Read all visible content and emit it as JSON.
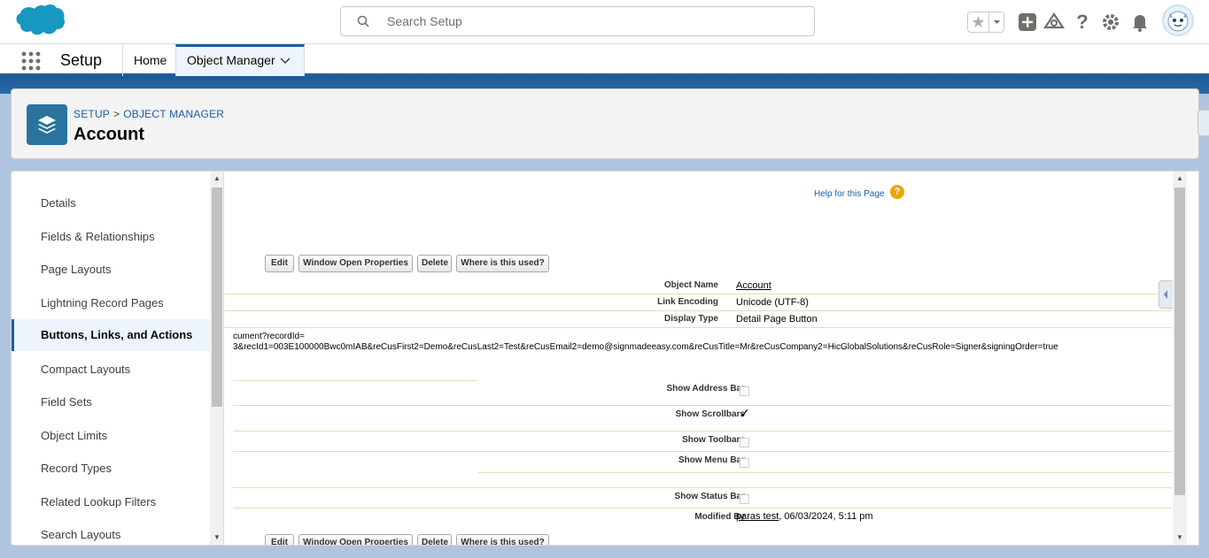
{
  "global_header": {
    "search_placeholder": "Search Setup"
  },
  "app_nav": {
    "app_name": "Setup",
    "tabs": [
      {
        "label": "Home"
      },
      {
        "label": "Object Manager"
      }
    ]
  },
  "page_header": {
    "breadcrumb": [
      "SETUP",
      "OBJECT MANAGER"
    ],
    "breadcrumb_separator": ">",
    "title": "Account"
  },
  "sidebar": {
    "items": [
      {
        "label": "Details"
      },
      {
        "label": "Fields & Relationships"
      },
      {
        "label": "Page Layouts"
      },
      {
        "label": "Lightning Record Pages"
      },
      {
        "label": "Buttons, Links, and Actions",
        "active": true
      },
      {
        "label": "Compact Layouts"
      },
      {
        "label": "Field Sets"
      },
      {
        "label": "Object Limits"
      },
      {
        "label": "Record Types"
      },
      {
        "label": "Related Lookup Filters"
      },
      {
        "label": "Search Layouts"
      }
    ]
  },
  "main": {
    "help_link": "Help for this Page",
    "help_icon": "?",
    "buttons": {
      "edit": "Edit",
      "window_open": "Window Open Properties",
      "delete": "Delete",
      "where_used": "Where is this used?"
    },
    "details": {
      "object_name_label": "Object Name",
      "object_name_value": "Account",
      "link_encoding_label": "Link Encoding",
      "link_encoding_value": "Unicode (UTF-8)",
      "display_type_label": "Display Type",
      "display_type_value": "Detail Page Button",
      "url_line1": "cument?recordId=",
      "url_line2": "3&recId1=003E100000Bwc0mIAB&reCusFirst2=Demo&reCusLast2=Test&reCusEmail2=demo@signmadeeasy.com&reCusTitle=Mr&reCusCompany2=HicGlobalSolutions&reCusRole=Signer&signingOrder=true",
      "show_address_bar_label": "Show Address Bar",
      "show_scrollbars_label": "Show Scrollbars",
      "show_scrollbars_check": "✓",
      "show_toolbars_label": "Show Toolbars",
      "show_menu_bar_label": "Show Menu Bar",
      "show_status_bar_label": "Show Status Bar",
      "modified_by_label": "Modified By",
      "modified_by_user": "paras test",
      "modified_by_date": ", 06/03/2024, 5:11 pm"
    }
  },
  "colors": {
    "brand_blue": "#1b5f9e",
    "link_blue": "#1b5fa8",
    "salesforce_cloud": "#1798c1",
    "object_icon": "#2a739e"
  }
}
